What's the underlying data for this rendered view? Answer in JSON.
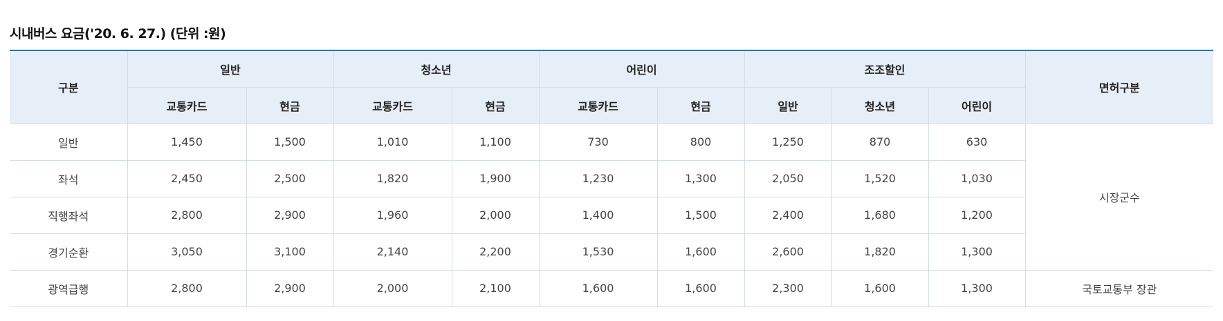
{
  "caption": "시내버스 요금('20. 6. 27.) (단위 :원)",
  "header": {
    "category": "구분",
    "groups": [
      "일반",
      "청소년",
      "어린이",
      "조조할인"
    ],
    "license": "면허구분",
    "sub": [
      "교통카드",
      "현금",
      "교통카드",
      "현금",
      "교통카드",
      "현금",
      "일반",
      "청소년",
      "어린이"
    ]
  },
  "rows": [
    {
      "name": "일반",
      "values": [
        "1,450",
        "1,500",
        "1,010",
        "1,100",
        "730",
        "800",
        "1,250",
        "870",
        "630"
      ]
    },
    {
      "name": "좌석",
      "values": [
        "2,450",
        "2,500",
        "1,820",
        "1,900",
        "1,230",
        "1,300",
        "2,050",
        "1,520",
        "1,030"
      ]
    },
    {
      "name": "직행좌석",
      "values": [
        "2,800",
        "2,900",
        "1,960",
        "2,000",
        "1,400",
        "1,500",
        "2,400",
        "1,680",
        "1,200"
      ]
    },
    {
      "name": "경기순환",
      "values": [
        "3,050",
        "3,100",
        "2,140",
        "2,200",
        "1,530",
        "1,600",
        "2,600",
        "1,820",
        "1,300"
      ]
    },
    {
      "name": "광역급행",
      "values": [
        "2,800",
        "2,900",
        "2,000",
        "2,100",
        "1,600",
        "1,600",
        "2,300",
        "1,600",
        "1,300"
      ]
    }
  ],
  "license_values": [
    "시장군수",
    "국토교통부 장관"
  ]
}
